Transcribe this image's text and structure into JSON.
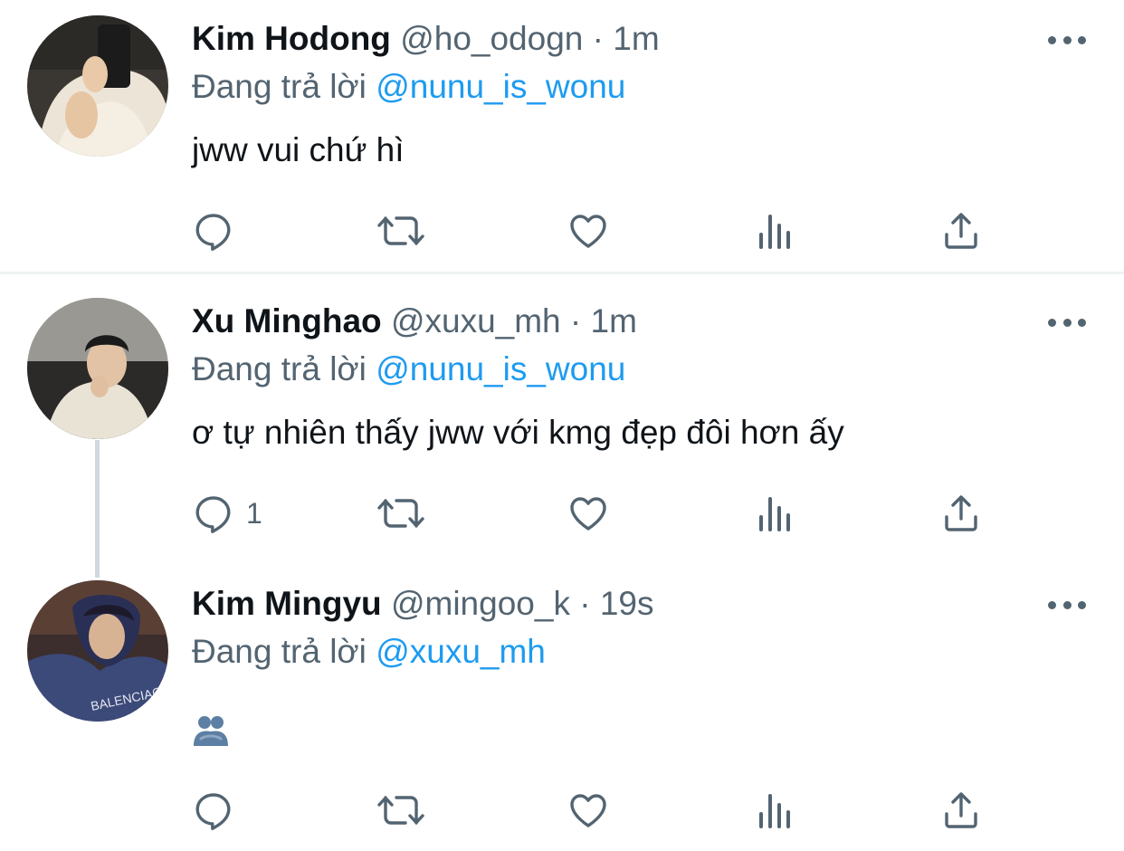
{
  "reply_prefix": "Đang trả lời",
  "tweets": [
    {
      "name": "Kim Hodong",
      "handle": "@ho_odogn",
      "dot": "·",
      "time": "1m",
      "reply_to": "@nunu_is_wonu",
      "text": "jww vui chứ hì",
      "reply_count": ""
    },
    {
      "name": "Xu Minghao",
      "handle": "@xuxu_mh",
      "dot": "·",
      "time": "1m",
      "reply_to": "@nunu_is_wonu",
      "text": "ơ tự nhiên thấy jww với kmg đẹp đôi hơn ấy",
      "reply_count": "1"
    },
    {
      "name": "Kim Mingyu",
      "handle": "@mingoo_k",
      "dot": "·",
      "time": "19s",
      "reply_to": "@xuxu_mh",
      "text": "",
      "emoji": "people-hugging-emoji",
      "reply_count": ""
    }
  ],
  "icons": {
    "reply": "reply-icon",
    "retweet": "retweet-icon",
    "like": "heart-icon",
    "views": "views-icon",
    "share": "share-icon",
    "more": "more-icon"
  },
  "colors": {
    "mention": "#1d9bf0",
    "secondary_text": "#536471",
    "primary_text": "#0f1419",
    "thread_line": "#cfd9de"
  }
}
